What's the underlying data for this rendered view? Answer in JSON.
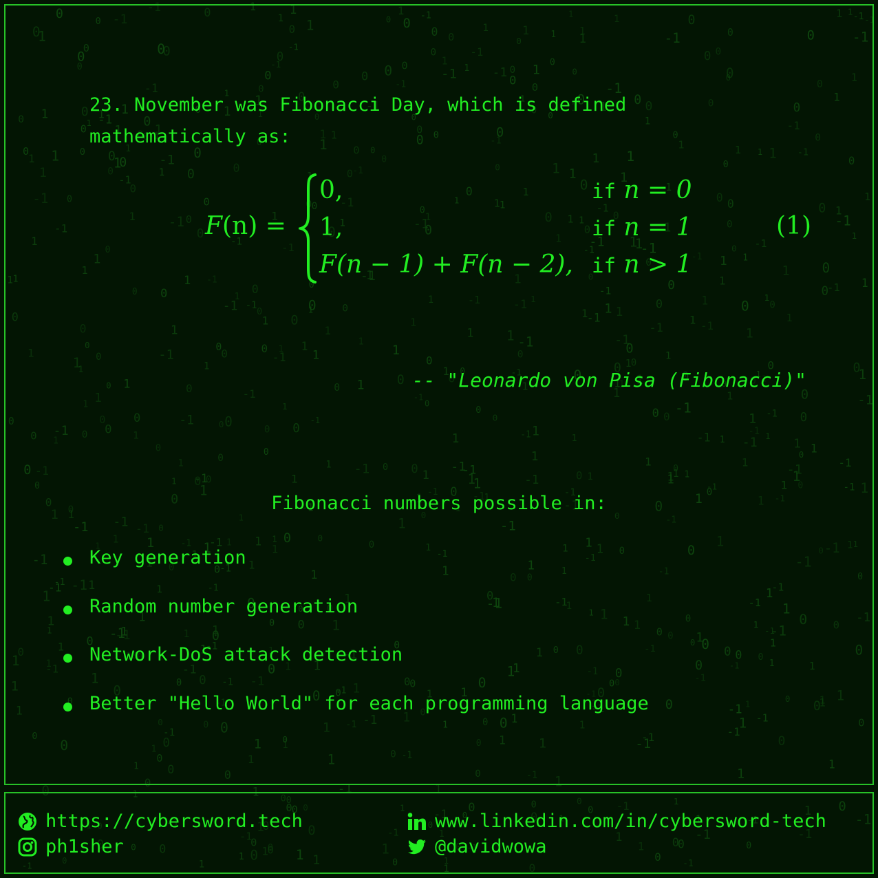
{
  "intro": "23. November was Fibonacci Day, which is defined mathematically as:",
  "equation": {
    "lhs_func": "F",
    "lhs_args": "(n) =",
    "cases": [
      {
        "value": "0,",
        "keyword": "if",
        "condition": "n = 0"
      },
      {
        "value": "1,",
        "keyword": "if",
        "condition": "n = 1"
      },
      {
        "value": "F(n − 1) + F(n − 2),",
        "keyword": "if",
        "condition": "n > 1"
      }
    ],
    "number": "(1)"
  },
  "quote": "-- \"Leonardo von Pisa (Fibonacci)\"",
  "subheading": "Fibonacci numbers possible in:",
  "bullets": [
    "Key generation",
    "Random number generation",
    "Network-DoS attack detection",
    "Better \"Hello World\" for each programming language"
  ],
  "footer": {
    "website": "https://cybersword.tech",
    "instagram": "ph1sher",
    "linkedin": "www.linkedin.com/in/cybersword-tech",
    "twitter": "@davidwowa",
    "icons": [
      "globe-icon",
      "instagram-icon",
      "linkedin-icon",
      "twitter-icon"
    ]
  },
  "colors": {
    "background": "#031503",
    "text": "#22ee22",
    "border": "#27c227",
    "rain": "#0f4a0f"
  }
}
